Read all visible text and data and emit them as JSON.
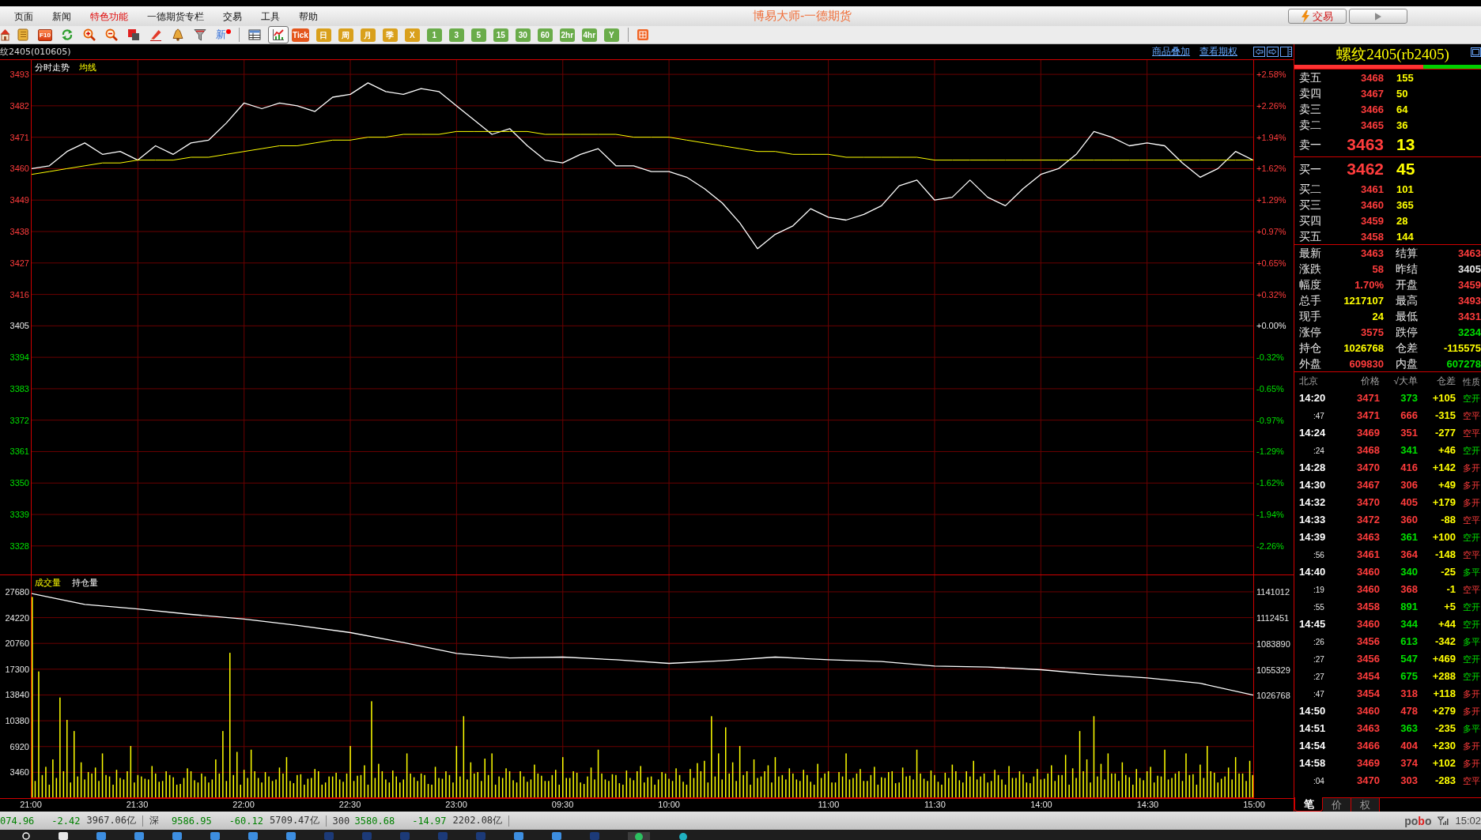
{
  "menu_bar": {
    "items": [
      {
        "label": "页面",
        "kind": "normal"
      },
      {
        "label": "新闻",
        "kind": "normal"
      },
      {
        "label": "特色功能",
        "kind": "featured"
      },
      {
        "label": "一德期货专栏",
        "kind": "normal"
      },
      {
        "label": "交易",
        "kind": "normal"
      },
      {
        "label": "工具",
        "kind": "normal"
      },
      {
        "label": "帮助",
        "kind": "normal"
      }
    ],
    "title": "博易大师-一德期货",
    "trade_button": {
      "label": "交易"
    }
  },
  "toolbar": {
    "f10_button": {
      "label": "F10"
    },
    "news_button": {
      "label": "新"
    },
    "view_modes": [
      {
        "selected": false
      },
      {
        "selected": true
      }
    ],
    "periods": [
      {
        "label": "Tick",
        "color": "#e4561c"
      },
      {
        "label": "日",
        "color": "#d9a01c"
      },
      {
        "label": "周",
        "color": "#d9a01c"
      },
      {
        "label": "月",
        "color": "#d9a01c"
      },
      {
        "label": "季",
        "color": "#d9a01c"
      },
      {
        "label": "X",
        "color": "#d9a01c"
      },
      {
        "label": "1",
        "color": "#6aac4a"
      },
      {
        "label": "3",
        "color": "#6aac4a"
      },
      {
        "label": "5",
        "color": "#6aac4a"
      },
      {
        "label": "15",
        "color": "#6aac4a"
      },
      {
        "label": "30",
        "color": "#6aac4a"
      },
      {
        "label": "60",
        "color": "#6aac4a"
      },
      {
        "label": "2hr",
        "color": "#6aac4a"
      },
      {
        "label": "4hr",
        "color": "#6aac4a"
      },
      {
        "label": "Y",
        "color": "#6aac4a"
      }
    ]
  },
  "chart_header": {
    "contract": "纹2405(010605)",
    "links": [
      "商品叠加",
      "查看期权"
    ]
  },
  "price_panel": {
    "chart_data": {
      "type": "line",
      "grid": true,
      "ylim": [
        3318,
        3498
      ],
      "yticks": [
        3493,
        3482,
        3471,
        3460,
        3449,
        3438,
        3427,
        3416,
        3405,
        3394,
        3383,
        3372,
        3361,
        3350,
        3339,
        3328
      ],
      "series": [
        {
          "name": "分时走势",
          "color": "#ffffff",
          "values": [
            3460,
            3461,
            3466,
            3469,
            3465,
            3466,
            3463,
            3468,
            3465,
            3469,
            3470,
            3476,
            3483,
            3481,
            3483,
            3482,
            3480,
            3485,
            3486,
            3490,
            3487,
            3486,
            3488,
            3487,
            3482,
            3477,
            3472,
            3474,
            3468,
            3463,
            3462,
            3465,
            3467,
            3461,
            3461,
            3459,
            3459,
            3457,
            3453,
            3448,
            3441,
            3432,
            3437,
            3440,
            3446,
            3443,
            3442,
            3444,
            3447,
            3454,
            3456,
            3449,
            3450,
            3456,
            3450,
            3447,
            3453,
            3458,
            3460,
            3465,
            3473,
            3471,
            3468,
            3469,
            3468,
            3462,
            3457,
            3460,
            3466,
            3463
          ]
        },
        {
          "name": "均线",
          "color": "#ffff00",
          "values": [
            3458,
            3459,
            3460,
            3461,
            3462,
            3462,
            3463,
            3463,
            3463,
            3464,
            3464,
            3465,
            3466,
            3467,
            3468,
            3468,
            3469,
            3470,
            3470,
            3471,
            3471,
            3472,
            3472,
            3472,
            3473,
            3473,
            3473,
            3473,
            3473,
            3472,
            3472,
            3472,
            3472,
            3472,
            3471,
            3471,
            3471,
            3470,
            3469,
            3468,
            3467,
            3466,
            3466,
            3465,
            3465,
            3465,
            3464,
            3464,
            3464,
            3464,
            3464,
            3463,
            3463,
            3463,
            3463,
            3463,
            3463,
            3463,
            3463,
            3463,
            3463,
            3463,
            3463,
            3463,
            3463,
            3463,
            3463,
            3463,
            3463,
            3463
          ]
        }
      ]
    },
    "percent_labels": [
      {
        "label": "+2.58%",
        "color": "#ff3c3c"
      },
      {
        "label": "+2.26%",
        "color": "#ff3c3c"
      },
      {
        "label": "+1.94%",
        "color": "#ff3c3c"
      },
      {
        "label": "+1.62%",
        "color": "#ff3c3c"
      },
      {
        "label": "+1.29%",
        "color": "#ff3c3c"
      },
      {
        "label": "+0.97%",
        "color": "#ff3c3c"
      },
      {
        "label": "+0.65%",
        "color": "#ff3c3c"
      },
      {
        "label": "+0.32%",
        "color": "#ff3c3c"
      },
      {
        "label": "+0.00%",
        "color": "#e6e6e6"
      },
      {
        "label": "-0.32%",
        "color": "#00e000"
      },
      {
        "label": "-0.65%",
        "color": "#00e000"
      },
      {
        "label": "-0.97%",
        "color": "#00e000"
      },
      {
        "label": "-1.29%",
        "color": "#00e000"
      },
      {
        "label": "-1.62%",
        "color": "#00e000"
      },
      {
        "label": "-1.94%",
        "color": "#00e000"
      },
      {
        "label": "-2.26%",
        "color": "#00e000"
      }
    ]
  },
  "volume_panel": {
    "chart_data": {
      "type": "bar",
      "grid": true,
      "categories": [
        "21:00",
        null,
        null,
        null,
        null,
        null,
        null,
        null,
        null,
        null,
        null,
        null,
        null,
        null,
        null,
        null,
        null,
        null,
        null,
        null,
        null,
        null,
        null,
        null,
        null,
        null,
        null,
        null,
        null,
        null,
        "21:30",
        null,
        null,
        null,
        null,
        null,
        null,
        null,
        null,
        null,
        null,
        null,
        null,
        null,
        null,
        null,
        null,
        null,
        null,
        null,
        null,
        null,
        null,
        null,
        null,
        null,
        null,
        null,
        null,
        null,
        "22:00",
        null,
        null,
        null,
        null,
        null,
        null,
        null,
        null,
        null,
        null,
        null,
        null,
        null,
        null,
        null,
        null,
        null,
        null,
        null,
        null,
        null,
        null,
        null,
        null,
        null,
        null,
        null,
        null,
        null,
        "22:30",
        null,
        null,
        null,
        null,
        null,
        null,
        null,
        null,
        null,
        null,
        null,
        null,
        null,
        null,
        null,
        null,
        null,
        null,
        null,
        null,
        null,
        null,
        null,
        null,
        null,
        null,
        null,
        null,
        null,
        "23:00",
        null,
        null,
        null,
        null,
        null,
        null,
        null,
        null,
        null,
        null,
        null,
        null,
        null,
        null,
        null,
        null,
        null,
        null,
        null,
        null,
        null,
        null,
        null,
        null,
        null,
        null,
        null,
        null,
        null,
        "09:30",
        null,
        null,
        null,
        null,
        null,
        null,
        null,
        null,
        null,
        null,
        null,
        null,
        null,
        null,
        null,
        null,
        null,
        null,
        null,
        null,
        null,
        null,
        null,
        null,
        null,
        null,
        null,
        null,
        null,
        "10:00",
        null,
        null,
        null,
        null,
        null,
        null,
        null,
        null,
        null,
        null,
        null,
        null,
        null,
        null,
        null,
        null,
        null,
        null,
        null,
        null,
        null,
        null,
        null,
        null,
        null,
        null,
        null,
        null,
        null,
        null,
        null,
        null,
        null,
        null,
        null,
        null,
        null,
        null,
        null,
        null,
        null,
        null,
        null,
        null,
        "11:00",
        null,
        null,
        null,
        null,
        null,
        null,
        null,
        null,
        null,
        null,
        null,
        null,
        null,
        null,
        null,
        null,
        null,
        null,
        null,
        null,
        null,
        null,
        null,
        null,
        null,
        null,
        null,
        null,
        null,
        "11:30",
        null,
        null,
        null,
        null,
        null,
        null,
        null,
        null,
        null,
        null,
        null,
        null,
        null,
        null,
        null,
        null,
        null,
        null,
        null,
        null,
        null,
        null,
        null,
        null,
        null,
        null,
        null,
        null,
        null,
        "14:00",
        null,
        null,
        null,
        null,
        null,
        null,
        null,
        null,
        null,
        null,
        null,
        null,
        null,
        null,
        null,
        null,
        null,
        null,
        null,
        null,
        null,
        null,
        null,
        null,
        null,
        null,
        null,
        null,
        null,
        "14:30",
        null,
        null,
        null,
        null,
        null,
        null,
        null,
        null,
        null,
        null,
        null,
        null,
        null,
        null,
        null,
        null,
        null,
        null,
        null,
        null,
        null,
        null,
        null,
        null,
        null,
        null,
        null,
        null,
        null,
        "15:00"
      ],
      "ylim": [
        0,
        29900
      ],
      "yticks": [
        27680,
        24220,
        20760,
        17300,
        13840,
        10380,
        6920,
        3460
      ],
      "series": [
        {
          "name": "成交量",
          "color": "#ffff00",
          "values": [
            27000,
            2300,
            17000,
            3100,
            4200,
            1800,
            5200,
            2700,
            13500,
            3600,
            10500,
            2100,
            9000,
            2900,
            4800,
            2500,
            3500,
            3300,
            4100,
            2300,
            6000,
            3100,
            2900,
            1800,
            3800,
            2700,
            2500,
            3600,
            7000,
            2100,
            3100,
            2900,
            2600,
            2500,
            4300,
            3300,
            2200,
            2300,
            3600,
            3100,
            2800,
            1800,
            1900,
            2700,
            4000,
            3600,
            2400,
            2100,
            3300,
            2900,
            2100,
            2500,
            5200,
            3300,
            9000,
            2300,
            19500,
            3100,
            6200,
            1800,
            3800,
            2700,
            6500,
            3600,
            2700,
            2100,
            3500,
            2900,
            2300,
            2500,
            4100,
            3300,
            5500,
            2300,
            2000,
            3100,
            3200,
            1800,
            2600,
            2700,
            3900,
            3600,
            1800,
            2100,
            2900,
            2900,
            3400,
            2500,
            2200,
            3300,
            7000,
            2300,
            3000,
            3100,
            4400,
            1800,
            13000,
            2700,
            4600,
            3600,
            2500,
            2100,
            3700,
            2900,
            2100,
            2500,
            6000,
            3300,
            2800,
            2300,
            3300,
            3100,
            1900,
            1800,
            4200,
            2700,
            2600,
            3600,
            3100,
            2100,
            7000,
            2900,
            11000,
            2500,
            4800,
            3300,
            3500,
            2300,
            5300,
            3100,
            6000,
            1800,
            2900,
            2700,
            4000,
            3600,
            2400,
            2100,
            3600,
            2900,
            2200,
            2500,
            4500,
            3300,
            3000,
            2300,
            2300,
            3100,
            3800,
            1800,
            5500,
            2700,
            2700,
            3600,
            3400,
            2100,
            1900,
            2900,
            4100,
            2500,
            6500,
            3300,
            2500,
            2300,
            3200,
            3100,
            2000,
            1800,
            3700,
            2700,
            2400,
            3600,
            4300,
            2100,
            2800,
            2900,
            1800,
            2500,
            3500,
            3300,
            2600,
            2300,
            4000,
            3100,
            2200,
            1800,
            3900,
            2700,
            4700,
            3600,
            5000,
            2100,
            11000,
            2900,
            6000,
            2500,
            9500,
            3300,
            4800,
            2300,
            7000,
            3100,
            3600,
            1800,
            5200,
            2700,
            2900,
            3600,
            4400,
            2100,
            5500,
            2900,
            3100,
            2500,
            4000,
            3300,
            2500,
            2300,
            3800,
            3100,
            2200,
            1800,
            4600,
            2700,
            3300,
            3600,
            2100,
            2100,
            3500,
            2900,
            6000,
            2500,
            2700,
            3300,
            3900,
            2300,
            2300,
            3100,
            4200,
            1800,
            2800,
            2700,
            3500,
            3600,
            2000,
            2100,
            4100,
            2900,
            3000,
            2500,
            6500,
            3300,
            2600,
            2300,
            3700,
            3100,
            2200,
            1800,
            3400,
            2700,
            4500,
            3600,
            2400,
            2100,
            3600,
            2900,
            5000,
            2500,
            2900,
            3300,
            2100,
            2300,
            3800,
            3100,
            2500,
            1800,
            4300,
            2700,
            2700,
            3600,
            3200,
            2100,
            2000,
            2900,
            3900,
            2500,
            2600,
            3300,
            4400,
            2300,
            3100,
            3100,
            5800,
            1800,
            4000,
            2700,
            9000,
            3600,
            5200,
            2100,
            11000,
            2900,
            4600,
            2500,
            6000,
            3300,
            3300,
            2300,
            4800,
            3100,
            2800,
            1800,
            3900,
            2700,
            2400,
            3600,
            4200,
            2100,
            3000,
            2900,
            6500,
            2500,
            2700,
            3300,
            3600,
            2300,
            6000,
            3100,
            3200,
            1800,
            4500,
            2700,
            7000,
            3600,
            3400,
            2100,
            2600,
            2900,
            4100,
            2500,
            5500,
            3300,
            3300,
            2300,
            5000,
            3100
          ]
        }
      ]
    },
    "open_interest": {
      "chart_data": {
        "type": "line",
        "ylim": [
          914250,
          1159190
        ],
        "yticks": [
          1141012,
          1112451,
          1083890,
          1055329,
          1026768
        ],
        "series": [
          {
            "name": "持仓量",
            "color": "#ffffff",
            "values": [
              1139000,
              1127000,
              1122000,
              1116000,
              1111000,
              1104000,
              1096000,
              1085000,
              1073000,
              1068000,
              1069000,
              1066000,
              1062000,
              1065000,
              1069000,
              1066000,
              1064000,
              1059000,
              1058000,
              1055000,
              1050000,
              1046000,
              1040000,
              1027000
            ]
          }
        ]
      }
    }
  },
  "quote_panel": {
    "title": "螺纹2405(rb2405)",
    "bid_ask_bar": {
      "level": 0.69
    },
    "asks": [
      {
        "label": "卖五",
        "price": "3468",
        "volume": "155"
      },
      {
        "label": "卖四",
        "price": "3467",
        "volume": "50"
      },
      {
        "label": "卖三",
        "price": "3466",
        "volume": "64"
      },
      {
        "label": "卖二",
        "price": "3465",
        "volume": "36"
      },
      {
        "label": "卖一",
        "price": "3463",
        "volume": "13"
      }
    ],
    "bids": [
      {
        "label": "买一",
        "price": "3462",
        "volume": "45"
      },
      {
        "label": "买二",
        "price": "3461",
        "volume": "101"
      },
      {
        "label": "买三",
        "price": "3460",
        "volume": "365"
      },
      {
        "label": "买四",
        "price": "3459",
        "volume": "28"
      },
      {
        "label": "买五",
        "price": "3458",
        "volume": "144"
      }
    ],
    "stats": [
      {
        "label": "最新",
        "value": "3463",
        "color": "#ff3c3c"
      },
      {
        "label": "结算",
        "value": "3463",
        "color": "#ff3c3c"
      },
      {
        "label": "涨跌",
        "value": "58",
        "color": "#ff3c3c"
      },
      {
        "label": "昨结",
        "value": "3405",
        "color": "#e6e6e6"
      },
      {
        "label": "幅度",
        "value": "1.70%",
        "color": "#ff3c3c"
      },
      {
        "label": "开盘",
        "value": "3459",
        "color": "#ff3c3c"
      },
      {
        "label": "总手",
        "value": "1217107",
        "color": "#ffff00"
      },
      {
        "label": "最高",
        "value": "3493",
        "color": "#ff3c3c"
      },
      {
        "label": "现手",
        "value": "24",
        "color": "#ffff00"
      },
      {
        "label": "最低",
        "value": "3431",
        "color": "#ff3c3c"
      },
      {
        "label": "涨停",
        "value": "3575",
        "color": "#ff3c3c"
      },
      {
        "label": "跌停",
        "value": "3234",
        "color": "#00e000"
      },
      {
        "label": "持仓",
        "value": "1026768",
        "color": "#ffff00"
      },
      {
        "label": "仓差",
        "value": "-115575",
        "color": "#ffff00"
      },
      {
        "label": "外盘",
        "value": "609830",
        "color": "#ff3c3c"
      },
      {
        "label": "内盘",
        "value": "607278",
        "color": "#00e000"
      }
    ],
    "trades": {
      "columns": [
        "北京",
        "价格",
        "√大单",
        "仓差",
        "性质"
      ],
      "rows": [
        {
          "kind": "minute",
          "time": "14:20",
          "price": "3471",
          "volume": "373",
          "change": "+105",
          "nature": "空开",
          "color": "#00e000"
        },
        {
          "kind": "second",
          "time": ":47",
          "price": "3471",
          "volume": "666",
          "change": "-315",
          "nature": "空平",
          "color": "#ff3c3c"
        },
        {
          "kind": "minute",
          "time": "14:24",
          "price": "3469",
          "volume": "351",
          "change": "-277",
          "nature": "空平",
          "color": "#ff3c3c"
        },
        {
          "kind": "second",
          "time": ":24",
          "price": "3468",
          "volume": "341",
          "change": "+46",
          "nature": "空开",
          "color": "#00e000"
        },
        {
          "kind": "minute",
          "time": "14:28",
          "price": "3470",
          "volume": "416",
          "change": "+142",
          "nature": "多开",
          "color": "#ff3c3c"
        },
        {
          "kind": "minute",
          "time": "14:30",
          "price": "3467",
          "volume": "306",
          "change": "+49",
          "nature": "多开",
          "color": "#ff3c3c"
        },
        {
          "kind": "minute",
          "time": "14:32",
          "price": "3470",
          "volume": "405",
          "change": "+179",
          "nature": "多开",
          "color": "#ff3c3c"
        },
        {
          "kind": "minute",
          "time": "14:33",
          "price": "3472",
          "volume": "360",
          "change": "-88",
          "nature": "空平",
          "color": "#ff3c3c"
        },
        {
          "kind": "minute",
          "time": "14:39",
          "price": "3463",
          "volume": "361",
          "change": "+100",
          "nature": "空开",
          "color": "#00e000"
        },
        {
          "kind": "second",
          "time": ":56",
          "price": "3461",
          "volume": "364",
          "change": "-148",
          "nature": "空平",
          "color": "#ff3c3c"
        },
        {
          "kind": "minute",
          "time": "14:40",
          "price": "3460",
          "volume": "340",
          "change": "-25",
          "nature": "多平",
          "color": "#00e000"
        },
        {
          "kind": "second",
          "time": ":19",
          "price": "3460",
          "volume": "368",
          "change": "-1",
          "nature": "空平",
          "color": "#ff3c3c"
        },
        {
          "kind": "second",
          "time": ":55",
          "price": "3458",
          "volume": "891",
          "change": "+5",
          "nature": "空开",
          "color": "#00e000"
        },
        {
          "kind": "minute",
          "time": "14:45",
          "price": "3460",
          "volume": "344",
          "change": "+44",
          "nature": "空开",
          "color": "#00e000"
        },
        {
          "kind": "second",
          "time": ":26",
          "price": "3456",
          "volume": "613",
          "change": "-342",
          "nature": "多平",
          "color": "#00e000"
        },
        {
          "kind": "second",
          "time": ":27",
          "price": "3456",
          "volume": "547",
          "change": "+469",
          "nature": "空开",
          "color": "#00e000"
        },
        {
          "kind": "second",
          "time": ":27",
          "price": "3454",
          "volume": "675",
          "change": "+288",
          "nature": "空开",
          "color": "#00e000"
        },
        {
          "kind": "second",
          "time": ":47",
          "price": "3454",
          "volume": "318",
          "change": "+118",
          "nature": "多开",
          "color": "#ff3c3c"
        },
        {
          "kind": "minute",
          "time": "14:50",
          "price": "3460",
          "volume": "478",
          "change": "+279",
          "nature": "多开",
          "color": "#ff3c3c"
        },
        {
          "kind": "minute",
          "time": "14:51",
          "price": "3463",
          "volume": "363",
          "change": "-235",
          "nature": "多平",
          "color": "#00e000"
        },
        {
          "kind": "minute",
          "time": "14:54",
          "price": "3466",
          "volume": "404",
          "change": "+230",
          "nature": "多开",
          "color": "#ff3c3c"
        },
        {
          "kind": "minute",
          "time": "14:58",
          "price": "3469",
          "volume": "374",
          "change": "+102",
          "nature": "多开",
          "color": "#ff3c3c"
        },
        {
          "kind": "second",
          "time": ":04",
          "price": "3470",
          "volume": "303",
          "change": "-283",
          "nature": "空平",
          "color": "#ff3c3c"
        }
      ]
    },
    "tabs": [
      {
        "label": "笔",
        "selected": true
      },
      {
        "label": "价",
        "selected": false
      },
      {
        "label": "权",
        "selected": false
      }
    ]
  },
  "status_bar": {
    "indices": [
      {
        "value": "074.96",
        "change": "-2.42",
        "turnover": "3967.06亿",
        "color": "#008000"
      },
      {
        "label": "深",
        "value": "9586.95",
        "change": "-60.12",
        "turnover": "5709.47亿",
        "color": "#008000"
      },
      {
        "label": "300",
        "value": "3580.68",
        "change": "-14.97",
        "turnover": "2202.08亿",
        "color": "#008000"
      }
    ],
    "brand": "pobo",
    "time": "15:02"
  }
}
